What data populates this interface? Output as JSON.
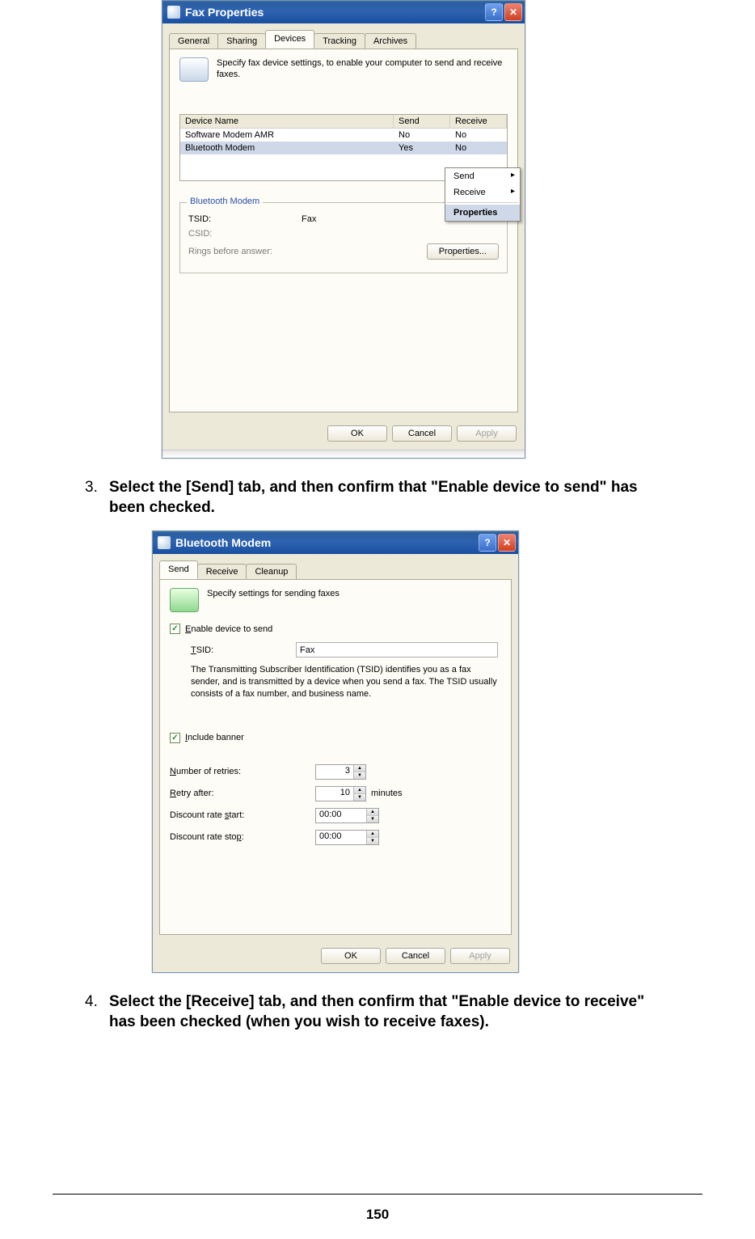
{
  "dialog1": {
    "title": "Fax Properties",
    "tabs": [
      "General",
      "Sharing",
      "Devices",
      "Tracking",
      "Archives"
    ],
    "active_tab": "Devices",
    "info": "Specify fax device settings, to enable your computer to send and receive faxes.",
    "table": {
      "headers": {
        "name": "Device Name",
        "send": "Send",
        "receive": "Receive"
      },
      "rows": [
        {
          "name": "Software Modem AMR",
          "send": "No",
          "receive": "No",
          "selected": false
        },
        {
          "name": "Bluetooth Modem",
          "send": "Yes",
          "receive": "No",
          "selected": true
        }
      ]
    },
    "context_menu": {
      "items": [
        "Send",
        "Receive",
        "Properties"
      ],
      "selected": "Properties"
    },
    "group": {
      "title": "Bluetooth Modem",
      "tsid_label": "TSID:",
      "tsid_value": "Fax",
      "csid_label": "CSID:",
      "rings_label": "Rings before answer:",
      "props_btn": "Properties..."
    },
    "buttons": {
      "ok": "OK",
      "cancel": "Cancel",
      "apply": "Apply"
    }
  },
  "step3": {
    "num": "3.",
    "text": "Select the [Send] tab, and then confirm that \"Enable device to send\" has been checked."
  },
  "dialog2": {
    "title": "Bluetooth Modem",
    "tabs": [
      "Send",
      "Receive",
      "Cleanup"
    ],
    "active_tab": "Send",
    "info": "Specify settings for sending faxes",
    "enable_label": "Enable device to send",
    "tsid_label": "TSID:",
    "tsid_value": "Fax",
    "tsid_help": "The Transmitting Subscriber Identification (TSID) identifies you as a fax sender, and is transmitted by a device when you send a fax. The TSID usually consists of a fax number, and business name.",
    "include_banner": "Include banner",
    "retries_label": "Number of retries:",
    "retries_value": "3",
    "retry_after_label": "Retry after:",
    "retry_after_value": "10",
    "retry_after_unit": "minutes",
    "disc_start_label": "Discount rate start:",
    "disc_start_value": "00:00",
    "disc_stop_label": "Discount rate stop:",
    "disc_stop_value": "00:00",
    "buttons": {
      "ok": "OK",
      "cancel": "Cancel",
      "apply": "Apply"
    }
  },
  "step4": {
    "num": "4.",
    "text": "Select the [Receive] tab, and then confirm that \"Enable device to receive\" has been checked (when you wish to receive faxes)."
  },
  "page_number": "150"
}
